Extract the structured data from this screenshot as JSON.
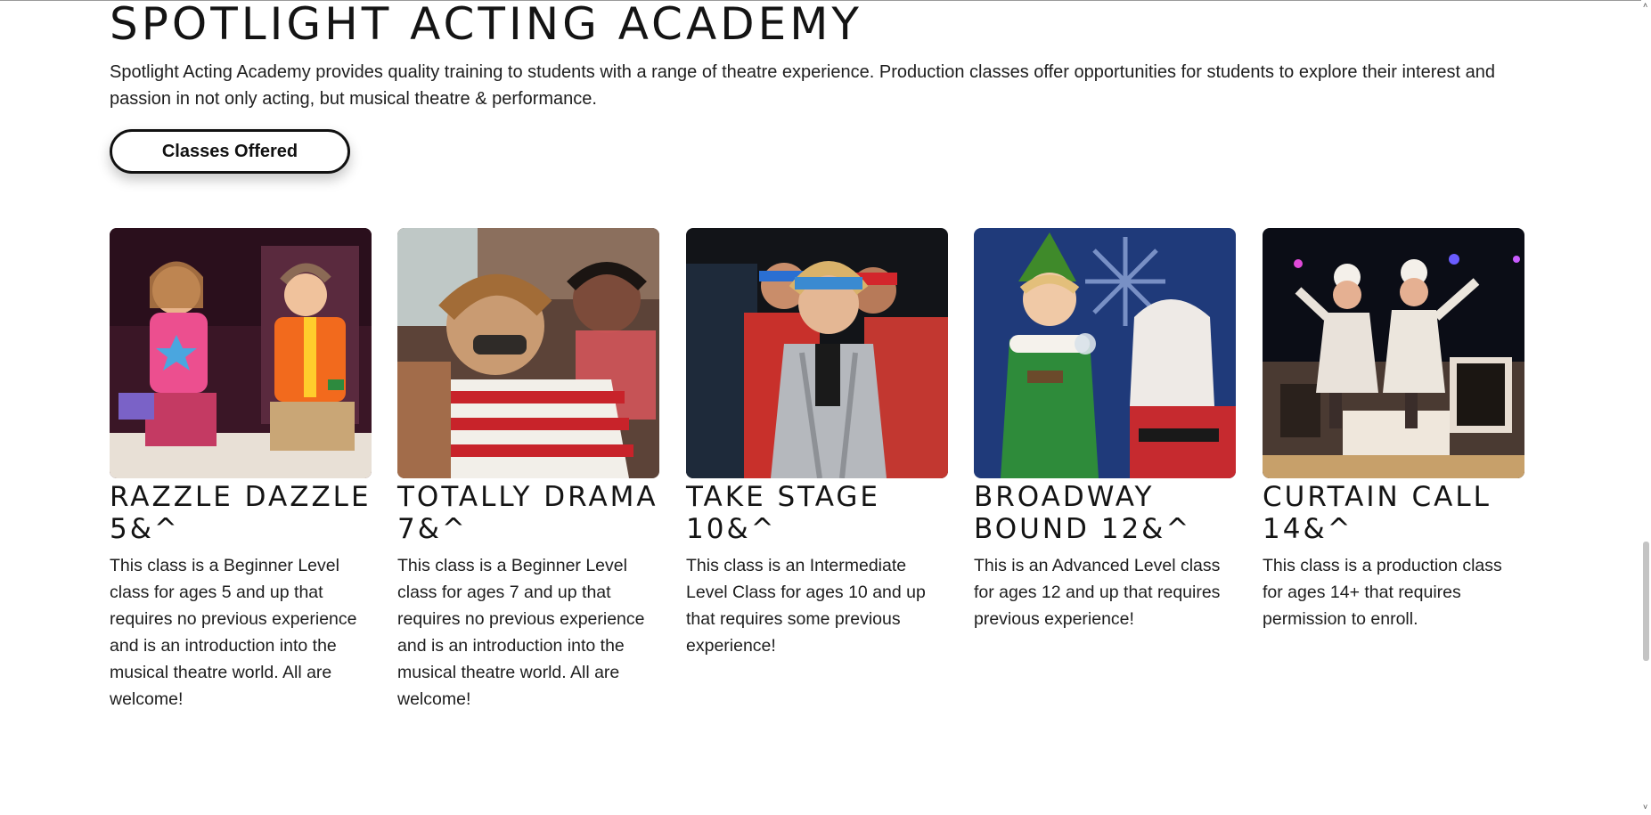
{
  "academy": {
    "title": "Spotlight Acting Academy",
    "intro": "Spotlight Acting Academy provides quality training to students with a range of theatre experience. Production classes offer opportunities for students to explore their interest and passion in not only acting, but musical theatre & performance.",
    "classes_button": "Classes Offered"
  },
  "classes": [
    {
      "title": "Razzle Dazzle 5&^",
      "description": "This class is a Beginner Level class for ages 5 and up that requires no previous experience and is an introduction into the musical theatre world. All are welcome!"
    },
    {
      "title": "Totally Drama 7&^",
      "description": "This class is a Beginner Level class for ages 7 and up that requires no previous experience and is an introduction into the musical theatre world. All are welcome!"
    },
    {
      "title": "Take Stage 10&^",
      "description": "This class is an Intermediate Level Class for ages 10 and up that requires some previous experience!"
    },
    {
      "title": "Broadway Bound 12&^",
      "description": "This is an Advanced Level class for ages 12 and up that requires previous experience!"
    },
    {
      "title": "Curtain Call 14&^",
      "description": "This class is a production class for ages 14+ that requires permission to enroll."
    }
  ],
  "scrollbar": {
    "up_glyph": "˄",
    "down_glyph": "˅"
  }
}
